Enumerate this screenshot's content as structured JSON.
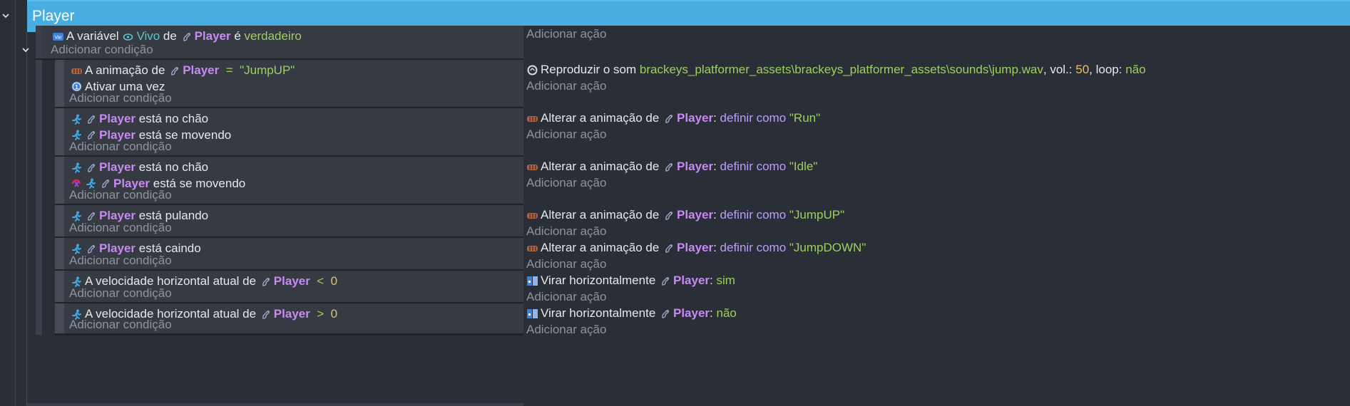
{
  "group": {
    "title": "Player"
  },
  "events": [
    {
      "id": "e0",
      "conditions": [
        {
          "icon": "variable-icon",
          "parts": [
            {
              "t": "A variável ",
              "c": "txt"
            },
            {
              "t": "variable-object-icon",
              "c": "icon"
            },
            {
              "t": "Vivo",
              "c": "var"
            },
            {
              "t": " de ",
              "c": "txt"
            },
            {
              "t": "sprite-object-icon",
              "c": "icon"
            },
            {
              "t": "Player",
              "c": "obj"
            },
            {
              "t": " é ",
              "c": "txt"
            },
            {
              "t": "verdadeiro",
              "c": "str"
            }
          ]
        }
      ],
      "add_condition": "Adicionar condição",
      "actions": [],
      "add_action": "Adicionar ação"
    },
    {
      "id": "e1",
      "conditions": [
        {
          "icon": "animation-icon",
          "parts": [
            {
              "t": "A animação de ",
              "c": "txt"
            },
            {
              "t": "sprite-object-icon",
              "c": "icon"
            },
            {
              "t": "Player",
              "c": "obj"
            },
            {
              "t": "  =  ",
              "c": "op"
            },
            {
              "t": "\"JumpUP\"",
              "c": "str"
            }
          ]
        },
        {
          "icon": "trigger-once-icon",
          "parts": [
            {
              "t": "Ativar uma vez",
              "c": "txt"
            }
          ]
        }
      ],
      "add_condition": "Adicionar condição",
      "actions": [
        {
          "icon": "sound-icon",
          "parts": [
            {
              "t": "Reproduzir o som ",
              "c": "txt"
            },
            {
              "t": "brackeys_platformer_assets\\brackeys_platformer_assets\\sounds\\jump.wav",
              "c": "str"
            },
            {
              "t": ", vol.: ",
              "c": "txt"
            },
            {
              "t": "50",
              "c": "num"
            },
            {
              "t": ", loop: ",
              "c": "txt"
            },
            {
              "t": "não",
              "c": "str"
            }
          ]
        }
      ],
      "add_action": "Adicionar ação"
    },
    {
      "id": "e2",
      "conditions": [
        {
          "icon": "platformer-icon",
          "parts": [
            {
              "t": "sprite-object-icon",
              "c": "icon"
            },
            {
              "t": "Player",
              "c": "obj"
            },
            {
              "t": " está no chão",
              "c": "txt"
            }
          ]
        },
        {
          "icon": "platformer-icon",
          "parts": [
            {
              "t": "sprite-object-icon",
              "c": "icon"
            },
            {
              "t": "Player",
              "c": "obj"
            },
            {
              "t": " está se movendo",
              "c": "txt"
            }
          ]
        }
      ],
      "add_condition": "Adicionar condição",
      "actions": [
        {
          "icon": "animation-icon",
          "parts": [
            {
              "t": "Alterar a animação de ",
              "c": "txt"
            },
            {
              "t": "sprite-object-icon",
              "c": "icon"
            },
            {
              "t": "Player",
              "c": "obj"
            },
            {
              "t": ": ",
              "c": "txt"
            },
            {
              "t": "definir como",
              "c": "kw"
            },
            {
              "t": " ",
              "c": "txt"
            },
            {
              "t": "\"Run\"",
              "c": "str"
            }
          ]
        }
      ],
      "add_action": "Adicionar ação"
    },
    {
      "id": "e3",
      "conditions": [
        {
          "icon": "platformer-icon",
          "parts": [
            {
              "t": "sprite-object-icon",
              "c": "icon"
            },
            {
              "t": "Player",
              "c": "obj"
            },
            {
              "t": " está no chão",
              "c": "txt"
            }
          ]
        },
        {
          "icon": "invert-icon",
          "parts": [
            {
              "t": "platformer-icon",
              "c": "icon"
            },
            {
              "t": "sprite-object-icon",
              "c": "icon"
            },
            {
              "t": "Player",
              "c": "obj"
            },
            {
              "t": " está se movendo",
              "c": "txt"
            }
          ]
        }
      ],
      "add_condition": "Adicionar condição",
      "actions": [
        {
          "icon": "animation-icon",
          "parts": [
            {
              "t": "Alterar a animação de ",
              "c": "txt"
            },
            {
              "t": "sprite-object-icon",
              "c": "icon"
            },
            {
              "t": "Player",
              "c": "obj"
            },
            {
              "t": ": ",
              "c": "txt"
            },
            {
              "t": "definir como",
              "c": "kw"
            },
            {
              "t": " ",
              "c": "txt"
            },
            {
              "t": "\"Idle\"",
              "c": "str"
            }
          ]
        }
      ],
      "add_action": "Adicionar ação"
    },
    {
      "id": "e4",
      "conditions": [
        {
          "icon": "platformer-icon",
          "parts": [
            {
              "t": "sprite-object-icon",
              "c": "icon"
            },
            {
              "t": "Player",
              "c": "obj"
            },
            {
              "t": " está pulando",
              "c": "txt"
            }
          ]
        }
      ],
      "add_condition": "Adicionar condição",
      "actions": [
        {
          "icon": "animation-icon",
          "parts": [
            {
              "t": "Alterar a animação de ",
              "c": "txt"
            },
            {
              "t": "sprite-object-icon",
              "c": "icon"
            },
            {
              "t": "Player",
              "c": "obj"
            },
            {
              "t": ": ",
              "c": "txt"
            },
            {
              "t": "definir como",
              "c": "kw"
            },
            {
              "t": " ",
              "c": "txt"
            },
            {
              "t": "\"JumpUP\"",
              "c": "str"
            }
          ]
        }
      ],
      "add_action": "Adicionar ação"
    },
    {
      "id": "e5",
      "conditions": [
        {
          "icon": "platformer-icon",
          "parts": [
            {
              "t": "sprite-object-icon",
              "c": "icon"
            },
            {
              "t": "Player",
              "c": "obj"
            },
            {
              "t": " está caindo",
              "c": "txt"
            }
          ]
        }
      ],
      "add_condition": "Adicionar condição",
      "actions": [
        {
          "icon": "animation-icon",
          "parts": [
            {
              "t": "Alterar a animação de ",
              "c": "txt"
            },
            {
              "t": "sprite-object-icon",
              "c": "icon"
            },
            {
              "t": "Player",
              "c": "obj"
            },
            {
              "t": ": ",
              "c": "txt"
            },
            {
              "t": "definir como",
              "c": "kw"
            },
            {
              "t": " ",
              "c": "txt"
            },
            {
              "t": "\"JumpDOWN\"",
              "c": "str"
            }
          ]
        }
      ],
      "add_action": "Adicionar ação"
    },
    {
      "id": "e6",
      "conditions": [
        {
          "icon": "platformer-icon",
          "parts": [
            {
              "t": "A velocidade horizontal atual de ",
              "c": "txt"
            },
            {
              "t": "sprite-object-icon",
              "c": "icon"
            },
            {
              "t": "Player",
              "c": "obj"
            },
            {
              "t": "  <  ",
              "c": "op"
            },
            {
              "t": "0",
              "c": "num"
            }
          ]
        }
      ],
      "add_condition": "Adicionar condição",
      "actions": [
        {
          "icon": "flip-icon",
          "parts": [
            {
              "t": "Virar horizontalmente ",
              "c": "txt"
            },
            {
              "t": "sprite-object-icon",
              "c": "icon"
            },
            {
              "t": "Player",
              "c": "obj"
            },
            {
              "t": ": ",
              "c": "txt"
            },
            {
              "t": "sim",
              "c": "str"
            }
          ]
        }
      ],
      "add_action": "Adicionar ação"
    },
    {
      "id": "e7",
      "conditions": [
        {
          "icon": "platformer-icon",
          "parts": [
            {
              "t": "A velocidade horizontal atual de ",
              "c": "txt"
            },
            {
              "t": "sprite-object-icon",
              "c": "icon"
            },
            {
              "t": "Player",
              "c": "obj"
            },
            {
              "t": "  >  ",
              "c": "op"
            },
            {
              "t": "0",
              "c": "num"
            }
          ]
        }
      ],
      "add_condition": "Adicionar condição",
      "actions": [
        {
          "icon": "flip-icon",
          "parts": [
            {
              "t": "Virar horizontalmente ",
              "c": "txt"
            },
            {
              "t": "sprite-object-icon",
              "c": "icon"
            },
            {
              "t": "Player",
              "c": "obj"
            },
            {
              "t": ": ",
              "c": "txt"
            },
            {
              "t": "não",
              "c": "str"
            }
          ]
        }
      ],
      "add_action": "Adicionar ação"
    }
  ],
  "colors": {
    "header_bg": "#48aee2",
    "object": "#c889f2",
    "string": "#9ecf63",
    "number": "#e8c069",
    "keyword": "#b8a0f5",
    "variable": "#5ec3c9",
    "muted": "#8e949e"
  }
}
